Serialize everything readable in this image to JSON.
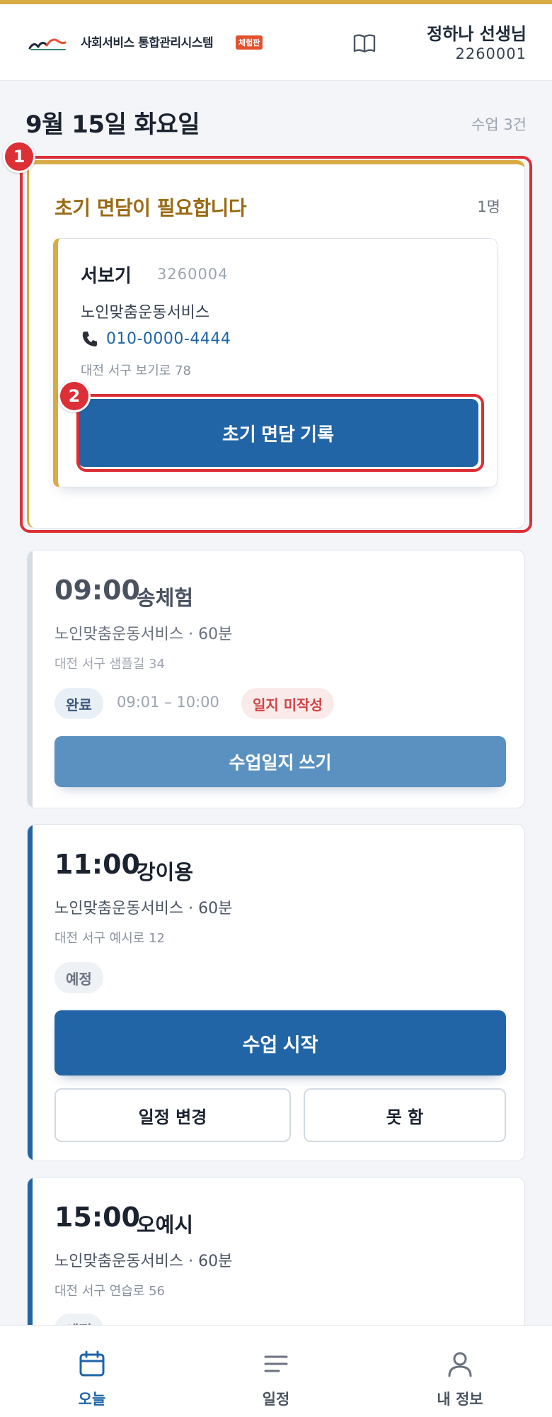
{
  "header": {
    "app_title": "사회서비스 통합관리시스템",
    "demo_badge": "체험판",
    "teacher_name": "정하나 선생님",
    "teacher_id": "2260001"
  },
  "summary": {
    "date": "9월 15일 화요일",
    "class_count": "수업 3건"
  },
  "markers": [
    "1",
    "2"
  ],
  "intake": {
    "title": "초기 면담이 필요합니다",
    "count": "1명",
    "client": {
      "name": "서보기",
      "id": "3260004",
      "service": "노인맞춤운동서비스",
      "phone": "010-0000-4444",
      "address": "대전 서구 보기로 78",
      "button": "초기 면담 기록"
    }
  },
  "classes": [
    {
      "time": "09:00",
      "person": "송체험",
      "service": "노인맞춤운동서비스 · 60분",
      "address": "대전 서구 샘플길 34",
      "status": "완료",
      "time_range": "09:01 – 10:00",
      "log_status": "일지 미작성",
      "button": "수업일지 쓰기"
    },
    {
      "time": "11:00",
      "person": "강이용",
      "service": "노인맞춤운동서비스 · 60분",
      "address": "대전 서구 예시로 12",
      "status": "예정",
      "button": "수업 시작",
      "secondary_buttons": [
        "일정 변경",
        "못 함"
      ]
    },
    {
      "time": "15:00",
      "person": "오예시",
      "service": "노인맞춤운동서비스 · 60분",
      "address": "대전 서구 연습로 56",
      "status": "예정"
    }
  ],
  "nav": [
    {
      "label": "오늘",
      "icon": "calendar-icon",
      "active": true
    },
    {
      "label": "일정",
      "icon": "list-icon",
      "active": false
    },
    {
      "label": "내 정보",
      "icon": "user-icon",
      "active": false
    }
  ],
  "colors": {
    "accent_gold": "#d9ab45",
    "primary_blue": "#2265a6",
    "highlight_red": "#dc2f36",
    "done_blue": "#5a91c0"
  }
}
